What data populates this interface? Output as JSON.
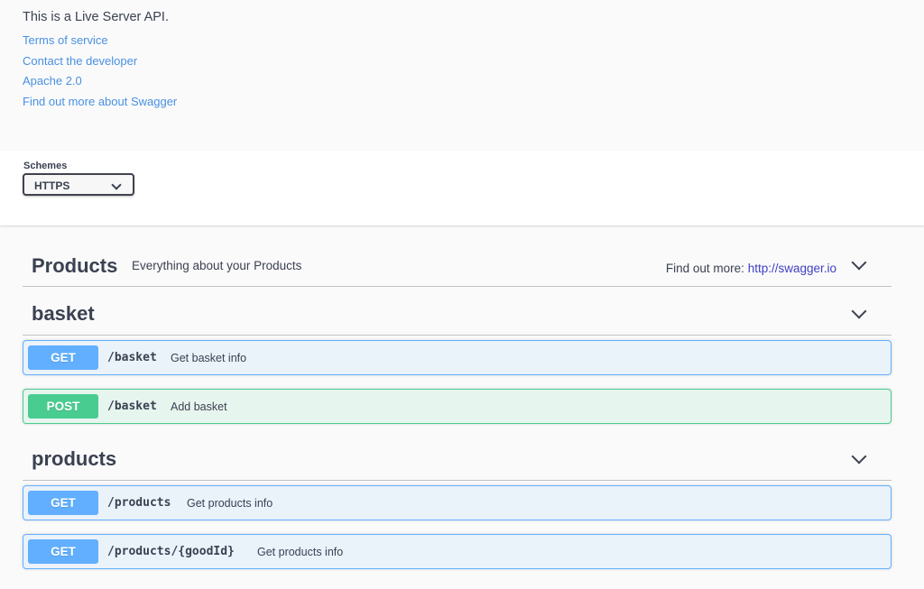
{
  "info": {
    "description": "This is a Live Server API.",
    "links": {
      "terms": "Terms of service",
      "contact": "Contact the developer",
      "license": "Apache 2.0",
      "swagger": "Find out more about Swagger"
    }
  },
  "schemes": {
    "title": "Schemes",
    "selected": "HTTPS"
  },
  "tags": {
    "products_main": {
      "name": "Products",
      "description": "Everything about your Products",
      "more_label": "Find out more:",
      "more_link": "http://swagger.io"
    },
    "basket": {
      "name": "basket"
    },
    "products": {
      "name": "products"
    }
  },
  "operations": {
    "basket_get": {
      "method": "GET",
      "path": "/basket",
      "summary": "Get basket info"
    },
    "basket_post": {
      "method": "POST",
      "path": "/basket",
      "summary": "Add basket"
    },
    "products_get": {
      "method": "GET",
      "path": "/products",
      "summary": "Get products info"
    },
    "product_get": {
      "method": "GET",
      "path": "/products/{goodId}",
      "summary": "Get products info"
    }
  },
  "colors": {
    "get": "#61affe",
    "post": "#49cc90",
    "link": "#4990e2"
  },
  "icons": [
    "chevron-down-icon",
    "select-chevron-icon"
  ]
}
